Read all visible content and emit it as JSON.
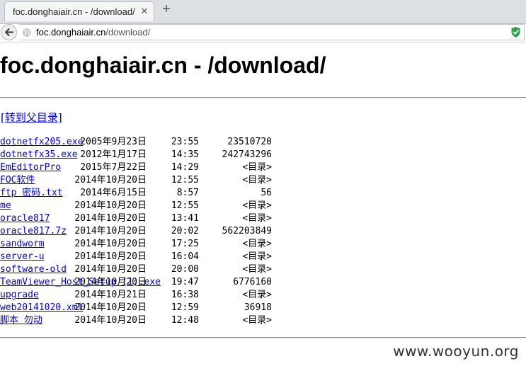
{
  "browser": {
    "tab_title": "foc.donghaiair.cn - /download/",
    "tab_close_glyph": "✕",
    "new_tab_glyph": "+",
    "url_host": "foc.donghaiair.cn",
    "url_path": "/download/",
    "icons": {
      "back": "back-arrow-icon",
      "site": "globe-icon",
      "security": "shield-check-icon"
    },
    "colors": {
      "shield": "#2ca24b",
      "link": "#0000ee"
    }
  },
  "page": {
    "title": "foc.donghaiair.cn - /download/",
    "parent_link": "[转到父目录]",
    "entries": [
      {
        "date": "2005年9月23日",
        "time": "23:55",
        "size": "23510720",
        "name": "dotnetfx205.exe"
      },
      {
        "date": "2012年1月17日",
        "time": "14:35",
        "size": "242743296",
        "name": "dotnetfx35.exe"
      },
      {
        "date": "2015年7月22日",
        "time": "14:29",
        "size": "<目录>",
        "name": "EmEditorPro"
      },
      {
        "date": "2014年10月20日",
        "time": "12:55",
        "size": "<目录>",
        "name": "FOC软件"
      },
      {
        "date": "2014年6月15日",
        "time": "8:57",
        "size": "56",
        "name": "ftp 密码.txt"
      },
      {
        "date": "2014年10月20日",
        "time": "12:55",
        "size": "<目录>",
        "name": "me"
      },
      {
        "date": "2014年10月20日",
        "time": "13:41",
        "size": "<目录>",
        "name": "oracle817"
      },
      {
        "date": "2014年10月20日",
        "time": "20:02",
        "size": "562203849",
        "name": "oracle817.7z"
      },
      {
        "date": "2014年10月20日",
        "time": "17:25",
        "size": "<目录>",
        "name": "sandworm"
      },
      {
        "date": "2014年10月20日",
        "time": "16:04",
        "size": "<目录>",
        "name": "server-u"
      },
      {
        "date": "2014年10月20日",
        "time": "20:00",
        "size": "<目录>",
        "name": "software-old"
      },
      {
        "date": "2014年10月20日",
        "time": "19:47",
        "size": "6776160",
        "name": "TeamViewer_Host_Setup (1).exe"
      },
      {
        "date": "2014年10月21日",
        "time": "16:38",
        "size": "<目录>",
        "name": "upgrade"
      },
      {
        "date": "2014年10月20日",
        "time": "12:59",
        "size": "36918",
        "name": "web20141020.xml"
      },
      {
        "date": "2014年10月20日",
        "time": "12:48",
        "size": "<目录>",
        "name": "脚本 勿动"
      }
    ]
  },
  "watermark": "www.wooyun.org"
}
